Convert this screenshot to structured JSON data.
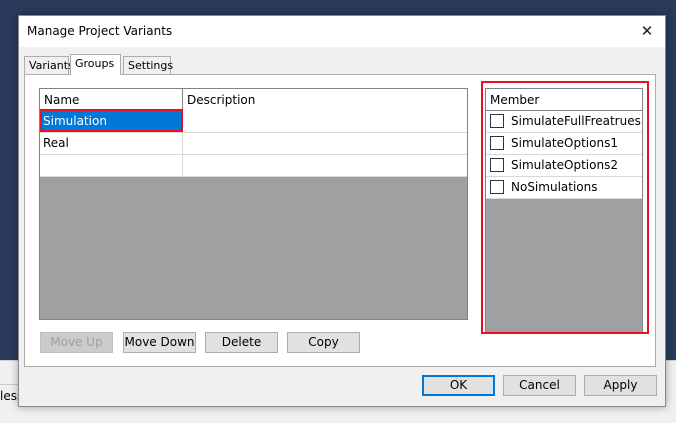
{
  "dialog": {
    "title": "Manage Project Variants",
    "close_glyph": "✕"
  },
  "tabs": [
    {
      "label": "Variants",
      "active": false
    },
    {
      "label": "Groups",
      "active": true
    },
    {
      "label": "Settings",
      "active": false
    }
  ],
  "groups_table": {
    "columns": [
      "Name",
      "Description"
    ],
    "rows": [
      {
        "name": "Simulation",
        "description": "",
        "selected": true
      },
      {
        "name": "Real",
        "description": "",
        "selected": false
      },
      {
        "name": "",
        "description": "",
        "selected": false
      }
    ]
  },
  "member_list": {
    "header": "Member",
    "items": [
      {
        "label": "SimulateFullFreatrues",
        "checked": false
      },
      {
        "label": "SimulateOptions1",
        "checked": false
      },
      {
        "label": "SimulateOptions2",
        "checked": false
      },
      {
        "label": "NoSimulations",
        "checked": false
      }
    ]
  },
  "group_buttons": {
    "move_up": "Move Up",
    "move_down": "Move Down",
    "delete": "Delete",
    "copy": "Copy"
  },
  "footer_buttons": {
    "ok": "OK",
    "cancel": "Cancel",
    "apply": "Apply"
  },
  "background": {
    "status_text": "less"
  },
  "colors": {
    "selection": "#0078d7",
    "highlight_border": "#e81123",
    "background_app": "#293a5b"
  }
}
